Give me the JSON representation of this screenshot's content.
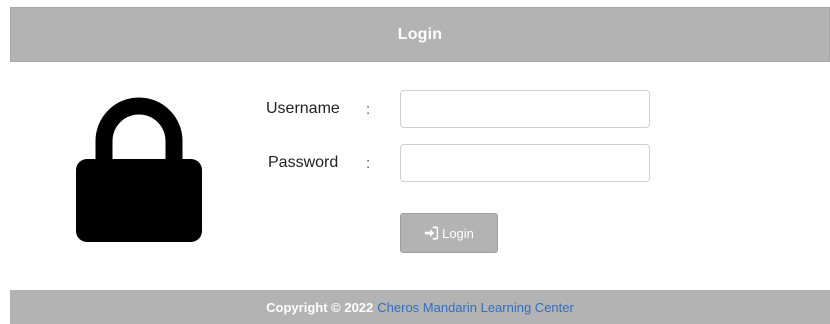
{
  "header": {
    "title": "Login"
  },
  "form": {
    "username_label": "Username",
    "password_label": "Password",
    "separator": ":",
    "username_value": "",
    "password_value": ""
  },
  "button": {
    "label": "Login",
    "icon": "sign-in-icon"
  },
  "lock_icon": "padlock-icon",
  "footer": {
    "copyright": "Copyright © 2022",
    "org_name": "Cheros Mandarin Learning Center",
    "link_color": "#2e6fc4"
  },
  "colors": {
    "bar_gray": "#b3b3b3",
    "white": "#ffffff"
  }
}
